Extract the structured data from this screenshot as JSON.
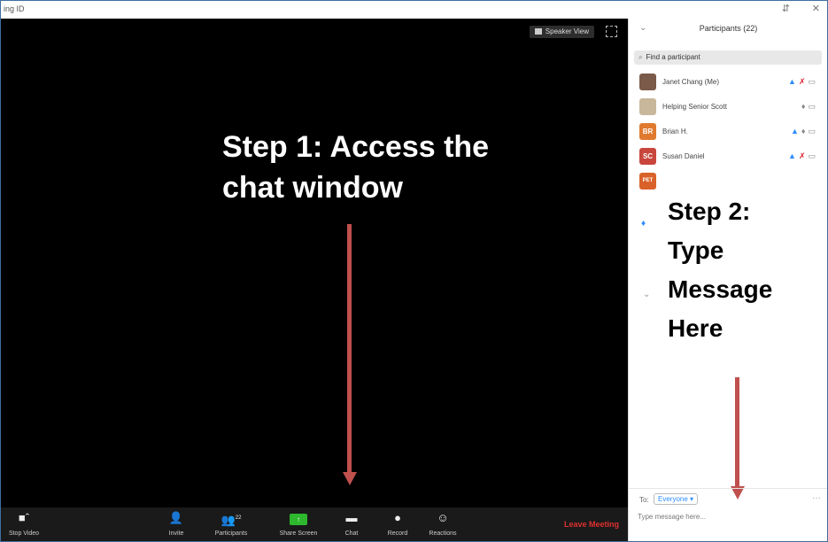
{
  "window": {
    "title": "ing ID",
    "controls": [
      "⇵",
      "✕"
    ]
  },
  "video": {
    "speaker_view_label": "Speaker View"
  },
  "annotations": {
    "step1": [
      "Step 1: Access the",
      "chat window"
    ],
    "step2": [
      "Step 2:",
      "Type",
      "Message",
      "Here"
    ],
    "arrow_color": "#c0504d"
  },
  "toolbar": {
    "items": [
      {
        "name": "start-video",
        "label": "Stop Video",
        "icon": "video-camera-icon"
      },
      {
        "name": "invite",
        "label": "Invite",
        "icon": "add-user-icon"
      },
      {
        "name": "participants",
        "label": "Participants",
        "icon": "participants-icon",
        "badge": "22"
      },
      {
        "name": "share-screen",
        "label": "Share Screen",
        "icon": "share-screen-icon"
      },
      {
        "name": "chat",
        "label": "Chat",
        "icon": "chat-icon"
      },
      {
        "name": "record",
        "label": "Record",
        "icon": "record-icon"
      },
      {
        "name": "reactions",
        "label": "Reactions",
        "icon": "reactions-icon"
      }
    ],
    "leave_label": "Leave Meeting",
    "leave_color": "#e03030"
  },
  "participants_panel": {
    "title": "Participants (22)",
    "search_placeholder": "Find a participant",
    "participants": [
      {
        "name": "Janet Chang (Me)",
        "initials": "",
        "color": "#7a5a48",
        "muted": true
      },
      {
        "name": "Helping Senior Scott",
        "initials": "",
        "color": "#c9b79c",
        "muted": false
      },
      {
        "name": "Brian H.",
        "initials": "BR",
        "color": "#e07a2e",
        "muted": false
      },
      {
        "name": "Susan Daniel",
        "initials": "SC",
        "color": "#c8463c",
        "muted": true
      },
      {
        "name": "",
        "initials": "PET",
        "color": "#d9622a",
        "muted": false
      }
    ]
  },
  "chat": {
    "to_label": "To:",
    "to_value": "Everyone",
    "input_placeholder": "Type message here..."
  }
}
